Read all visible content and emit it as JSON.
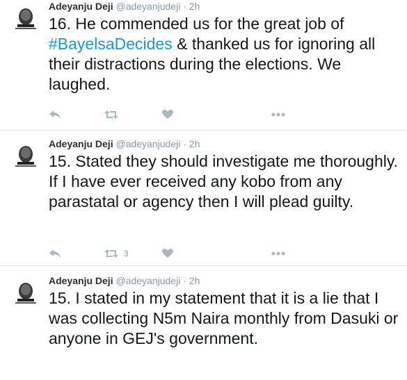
{
  "tweets": [
    {
      "name": "Adeyanju Deji",
      "handle": "@adeyanjudeji",
      "separator": "·",
      "time": "2h",
      "text_before": "16. He commended us for the great job of ",
      "hashtag": "#BayelsaDecides",
      "text_after": " & thanked us for ignoring all their distractions during the elections. We laughed.",
      "retweet_count": ""
    },
    {
      "name": "Adeyanju Deji",
      "handle": "@adeyanjudeji",
      "separator": "·",
      "time": "2h",
      "text_before": "15. Stated they should investigate me thoroughly. If I have ever received any kobo from any parastatal or agency then I will plead guilty.",
      "hashtag": "",
      "text_after": "",
      "retweet_count": "3"
    },
    {
      "name": "Adeyanju Deji",
      "handle": "@adeyanjudeji",
      "separator": "·",
      "time": "2h",
      "text_before": "15. I stated in my statement that it is a lie that I was collecting N5m Naira monthly from Dasuki or anyone in GEJ's government.",
      "hashtag": "",
      "text_after": "",
      "retweet_count": ""
    }
  ],
  "icons": {
    "reply": "reply-icon",
    "retweet": "retweet-icon",
    "like": "heart-icon",
    "more": "more-icon",
    "avatar": "avatar-portrait"
  },
  "colors": {
    "hashtag": "#1b95e0",
    "muted": "#8899a6",
    "action_icon": "#aab8c2",
    "divider": "#e1e8ed"
  }
}
